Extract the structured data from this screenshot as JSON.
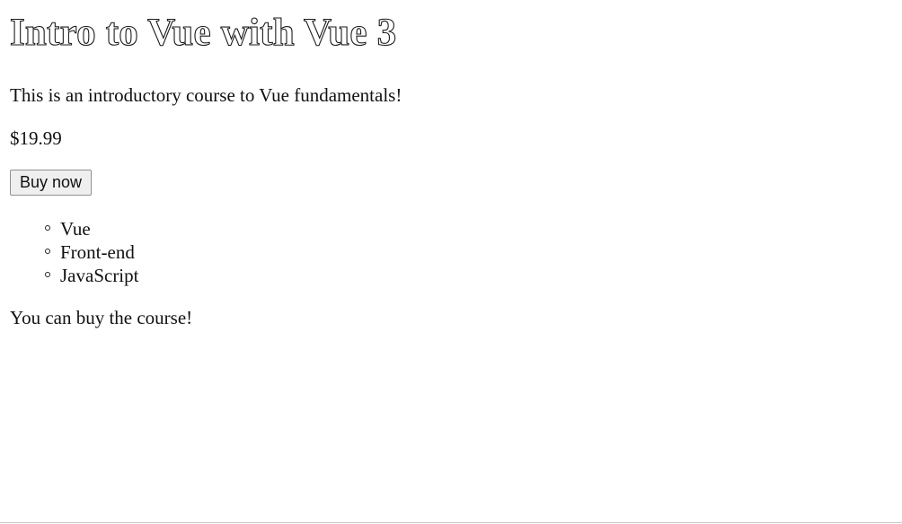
{
  "product": {
    "title": "Intro to Vue with Vue 3",
    "description": "This is an introductory course to Vue fundamentals!",
    "price": "$19.99",
    "buy_button_label": "Buy now",
    "tags": [
      "Vue",
      "Front-end",
      "JavaScript"
    ],
    "status_message": "You can buy the course!"
  },
  "icons": {
    "tag_bullet": "hollow-circle-bullet-icon"
  }
}
